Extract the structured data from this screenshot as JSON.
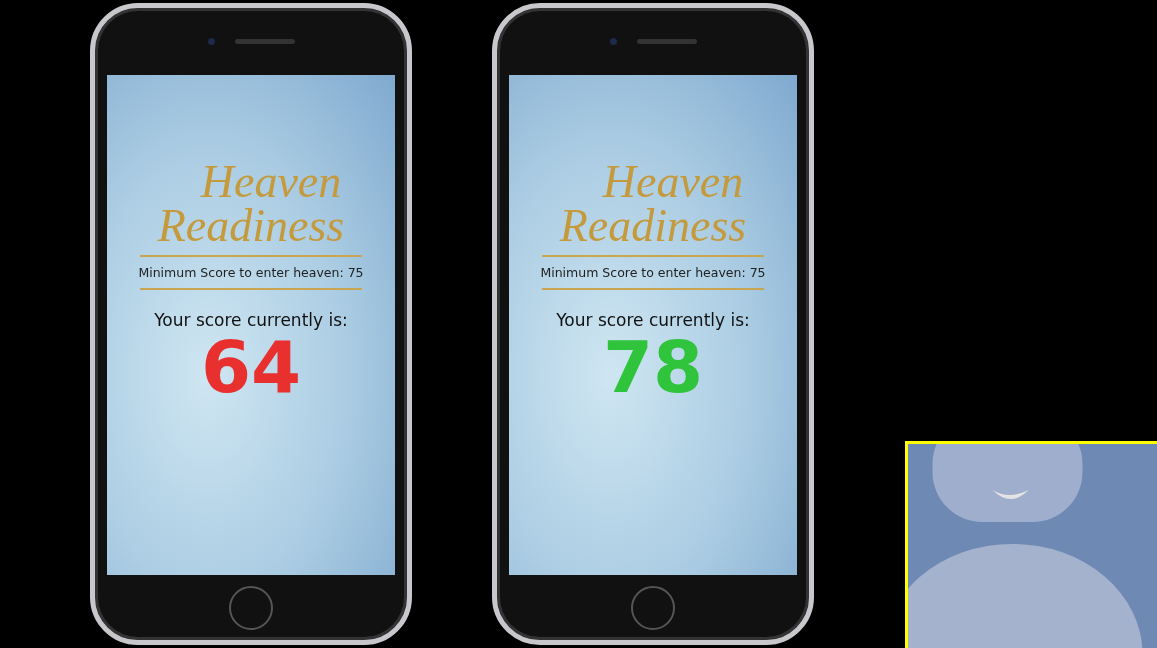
{
  "phones": [
    {
      "logo_line_1": "Heaven",
      "logo_line_2": "Readiness",
      "minimum_label": "Minimum Score to enter heaven: 75",
      "score_label": "Your score currently is:",
      "score": "64",
      "color": "#e8302f"
    },
    {
      "logo_line_1": "Heaven",
      "logo_line_2": "Readiness",
      "minimum_label": "Minimum Score to enter heaven: 75",
      "score_label": "Your score currently is:",
      "score": "78",
      "color": "#2fc43b"
    }
  ],
  "video_tile": {
    "active_speaker": true
  }
}
